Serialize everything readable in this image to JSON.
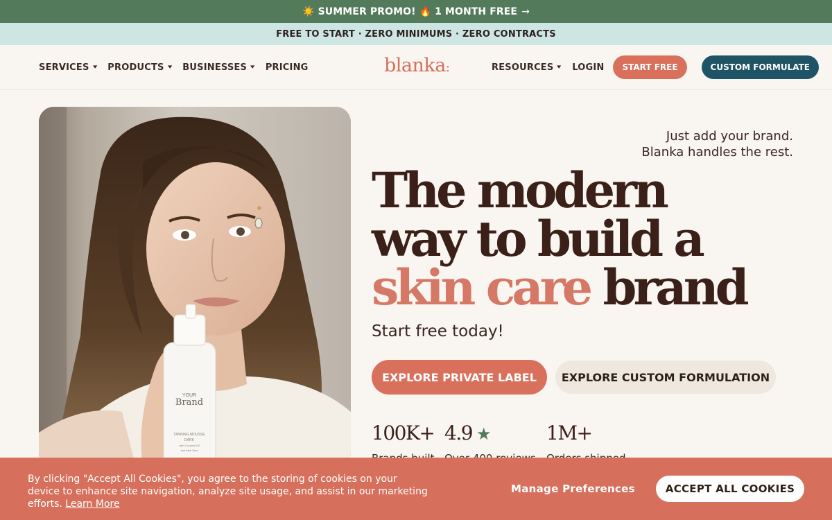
{
  "promo": {
    "sun_icon": "☀️",
    "text_a": "SUMMER PROMO!",
    "fire_icon": "🔥",
    "text_b": "1 MONTH FREE",
    "arrow": "→"
  },
  "subbar": {
    "text": "FREE TO START · ZERO MINIMUMS · ZERO CONTRACTS"
  },
  "nav": {
    "left": [
      {
        "label": "SERVICES",
        "has_dropdown": true
      },
      {
        "label": "PRODUCTS",
        "has_dropdown": true
      },
      {
        "label": "BUSINESSES",
        "has_dropdown": true
      },
      {
        "label": "PRICING",
        "has_dropdown": false
      }
    ],
    "logo": "blanka",
    "resources": "RESOURCES",
    "login": "LOGIN",
    "start_free": "START FREE",
    "custom_formulate": "CUSTOM FORMULATE",
    "chevron": "⌄"
  },
  "hero": {
    "tagline_1": "Just add your brand.",
    "tagline_2": "Blanka handles the rest.",
    "headline_1": "The modern",
    "headline_2": "way to build a",
    "headline_accent": "skin care",
    "headline_end": "brand",
    "subhead": "Start free today!",
    "cta_primary": "EXPLORE PRIVATE LABEL",
    "cta_secondary": "EXPLORE CUSTOM FORMULATION",
    "product": {
      "line1": "YOUR",
      "line2": "Brand",
      "line3": "TANNING MOUSSE",
      "line4": "DARK",
      "line5": "with Coconut Oil",
      "line6": "and Aloe Vera"
    }
  },
  "stats": [
    {
      "value": "100K+",
      "label": "Brands built"
    },
    {
      "value": "4.9",
      "label": "Over 400 reviews",
      "icon": "★"
    },
    {
      "value": "1M+",
      "label": "Orders shipped"
    }
  ],
  "cookie": {
    "text": "By clicking \"Accept All Cookies\", you agree to the storing of cookies on your device to enhance site navigation, analyze site usage,  and assist in our marketing efforts.",
    "learn_more": "Learn More",
    "manage": "Manage Preferences",
    "accept": "ACCEPT ALL COOKIES"
  },
  "colors": {
    "promo_bg": "#537a5b",
    "subbar_bg": "#cde6e3",
    "accent": "#d9705c",
    "dark_teal": "#1f5466",
    "page_bg": "#f9f5f1"
  }
}
